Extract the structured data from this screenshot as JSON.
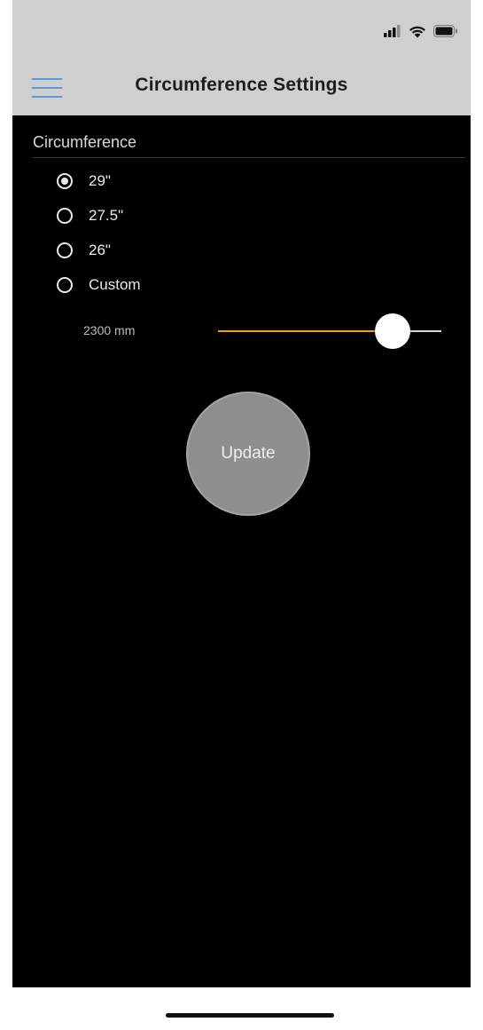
{
  "nav": {
    "title": "Circumference Settings"
  },
  "section": {
    "title": "Circumference"
  },
  "options": [
    {
      "label": "29\"",
      "selected": true
    },
    {
      "label": "27.5\"",
      "selected": false
    },
    {
      "label": "26\"",
      "selected": false
    },
    {
      "label": "Custom",
      "selected": false
    }
  ],
  "slider": {
    "value_label": "2300 mm",
    "fraction": 0.78,
    "fill_color": "#f0a020",
    "track_color": "#d8d8d8"
  },
  "update_button": {
    "label": "Update"
  },
  "icons": {
    "menu": "hamburger-menu-icon",
    "signal": "cellular-signal-icon",
    "wifi": "wifi-icon",
    "battery": "battery-icon"
  },
  "colors": {
    "accent": "#5b9ad6",
    "nav_background": "#cfcfcf",
    "content_background": "#000000",
    "button_gray": "#8e8e8e"
  }
}
